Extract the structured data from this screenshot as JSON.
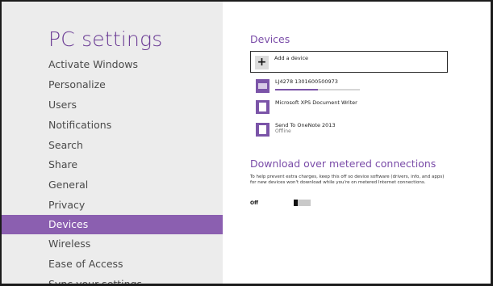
{
  "left": {
    "title": "PC settings",
    "nav": [
      {
        "label": "Activate Windows",
        "selected": false
      },
      {
        "label": "Personalize",
        "selected": false
      },
      {
        "label": "Users",
        "selected": false
      },
      {
        "label": "Notifications",
        "selected": false
      },
      {
        "label": "Search",
        "selected": false
      },
      {
        "label": "Share",
        "selected": false
      },
      {
        "label": "General",
        "selected": false
      },
      {
        "label": "Privacy",
        "selected": false
      },
      {
        "label": "Devices",
        "selected": true
      },
      {
        "label": "Wireless",
        "selected": false
      },
      {
        "label": "Ease of Access",
        "selected": false
      },
      {
        "label": "Sync your settings",
        "selected": false
      }
    ]
  },
  "right": {
    "devices_heading": "Devices",
    "add_device_label": "Add a device",
    "devices": [
      {
        "name": "LJ4278 1301600500973",
        "status": "",
        "icon": "keyboard-icon",
        "progress": 0.5
      },
      {
        "name": "Microsoft XPS Document Writer",
        "status": "",
        "icon": "printer-icon"
      },
      {
        "name": "Send To OneNote 2013",
        "status": "Offline",
        "icon": "printer-icon"
      }
    ],
    "metered": {
      "heading": "Download over metered connections",
      "description": "To help prevent extra charges, keep this off so device software (drivers, info, and apps) for new devices won't download while you're on metered Internet connections.",
      "toggle_label": "Off",
      "toggle_on": false
    }
  },
  "colors": {
    "accent": "#7b54a8",
    "selected_nav_bg": "#8b5fb0",
    "left_pane_bg": "#ececec",
    "heading": "#7a4ca8"
  }
}
